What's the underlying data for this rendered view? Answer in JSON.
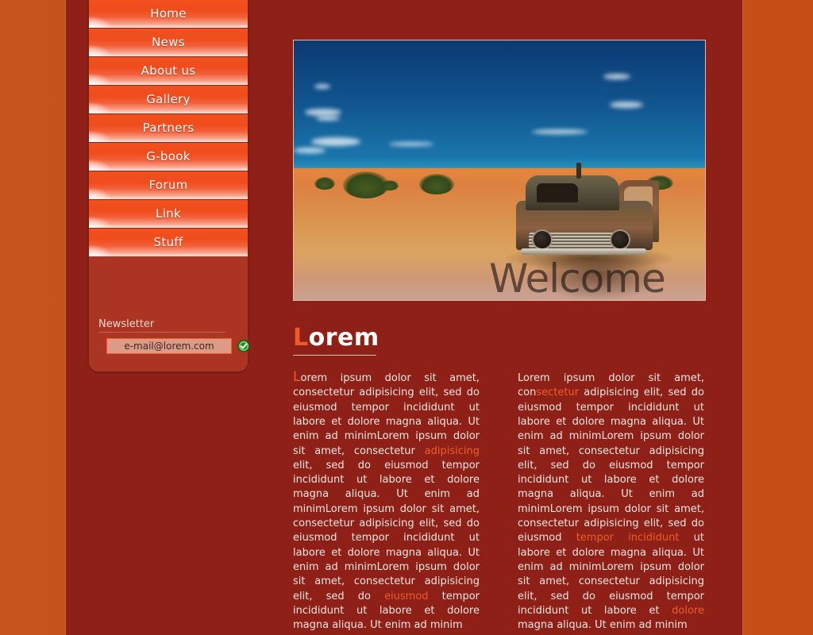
{
  "colors": {
    "outer_background": "#c4501b",
    "page_background": "#8f2017",
    "sidebar_panel": "#ab3522",
    "button_orange": "#f04c1c",
    "accent_link": "#ef5b28",
    "text": "#f0e6e2",
    "submit_green": "#2eac2e"
  },
  "sidebar": {
    "nav_items": [
      {
        "label": "Home"
      },
      {
        "label": "News"
      },
      {
        "label": "About us"
      },
      {
        "label": "Gallery"
      },
      {
        "label": "Partners"
      },
      {
        "label": "G-book"
      },
      {
        "label": "Forum"
      },
      {
        "label": "Link"
      },
      {
        "label": "Stuff"
      }
    ],
    "newsletter": {
      "label": "Newsletter",
      "input_value": "e-mail@lorem.com",
      "input_placeholder": "e-mail@lorem.com",
      "submit_icon": "green-check-icon"
    }
  },
  "hero": {
    "image_alt": "Rusted abandoned car in orange desert under blue sky",
    "overlay_text": "Welcome"
  },
  "article": {
    "title_cap": "L",
    "title_rest": "orem",
    "left_column": {
      "dropcap": "L",
      "part1": "orem ipsum dolor sit amet, consectetur adipisicing elit, sed do eiusmod tempor incididunt ut labore et dolore magna aliqua. Ut enim ad minimLorem ipsum dolor sit amet, consectetur ",
      "link1": "adipisicing",
      "part2": " elit, sed do eiusmod tempor incididunt ut labore et dolore magna aliqua. Ut enim ad minimLorem ipsum dolor sit amet, consectetur adipisicing elit, sed do eiusmod tempor incididunt ut labore et dolore magna aliqua. Ut enim ad minimLorem ipsum dolor sit amet, consectetur adipisicing elit, sed do ",
      "link2": "eiusmod",
      "part3": " tempor incididunt ut labore et dolore magna aliqua. Ut enim ad minim"
    },
    "right_column": {
      "part1": "Lorem ipsum dolor sit amet, con",
      "link1": "sectetur",
      "part2": " adipisicing elit, sed do eiusmod tempor incididunt ut labore et dolore magna aliqua. Ut enim ad minimLorem ipsum dolor sit amet, consectetur adipisicing elit, sed do eiusmod tempor incididunt ut labore et dolore magna aliqua. Ut enim ad minimLorem ipsum dolor sit amet, consectetur adipisicing elit, sed do eiusmod ",
      "link2": "tempor incididunt",
      "part3": " ut labore et dolore magna aliqua. Ut enim ad minimLorem ipsum dolor sit amet, consectetur adipisicing elit, sed do eiusmod tempor incididunt ut labore et ",
      "link3": "dolore",
      "part4": " magna aliqua. Ut enim ad minim"
    }
  }
}
